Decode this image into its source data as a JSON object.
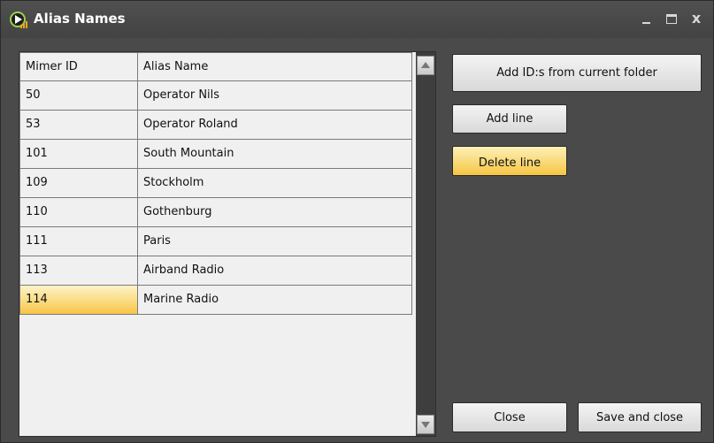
{
  "window": {
    "title": "Alias Names",
    "icon": "app-play-signal-icon",
    "controls": {
      "minimize": "minimize-icon",
      "maximize": "maximize-icon",
      "close": "x"
    }
  },
  "grid": {
    "columns": [
      "Mimer ID",
      "Alias Name"
    ],
    "rows": [
      {
        "id": "50",
        "alias": "Operator Nils"
      },
      {
        "id": "53",
        "alias": "Operator Roland"
      },
      {
        "id": "101",
        "alias": "South Mountain"
      },
      {
        "id": "109",
        "alias": "Stockholm"
      },
      {
        "id": "110",
        "alias": "Gothenburg"
      },
      {
        "id": "111",
        "alias": "Paris"
      },
      {
        "id": "113",
        "alias": "Airband Radio"
      },
      {
        "id": "114",
        "alias": "Marine Radio"
      }
    ],
    "selected_row_index": 7
  },
  "buttons": {
    "add_ids": "Add ID:s from current folder",
    "add_line": "Add line",
    "delete_line": "Delete line",
    "close": "Close",
    "save_close": "Save and close"
  },
  "colors": {
    "highlight": "#f7c646",
    "background": "#4a4a4a"
  }
}
